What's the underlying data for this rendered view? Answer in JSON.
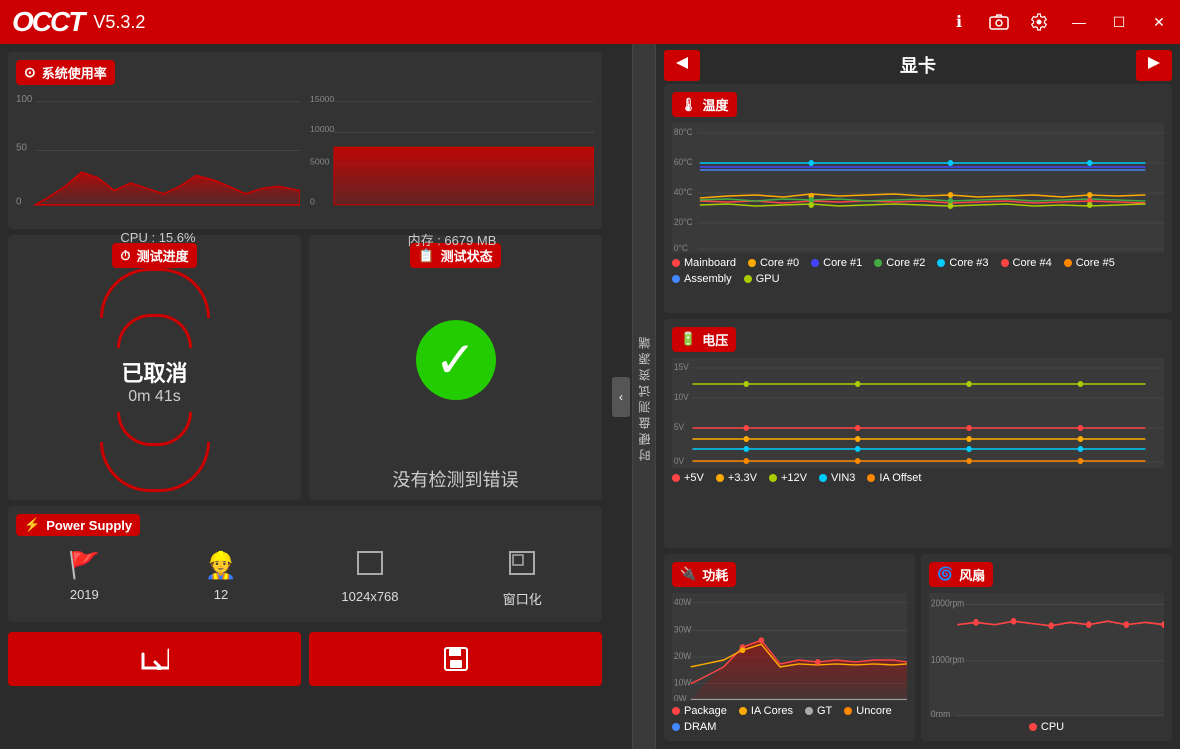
{
  "app": {
    "logo": "OCCT",
    "version": "V5.3.2",
    "title_controls": {
      "info": "ℹ",
      "screenshot": "📷",
      "settings": "🔧",
      "minimize": "—",
      "maximize": "☐",
      "close": "✕"
    }
  },
  "left": {
    "sys_usage_label": "系统使用率",
    "cpu_value": "CPU : 15.6%",
    "mem_value": "内存 : 6679 MB",
    "cpu_y_labels": [
      "100",
      "50",
      "0"
    ],
    "mem_y_labels": [
      "15000",
      "10000",
      "5000",
      "0"
    ],
    "test_progress_label": "测试进度",
    "test_status_label": "测试状态",
    "progress_main": "已取消",
    "progress_sub": "0m 41s",
    "status_text": "没有检测到错误",
    "power_supply_label": "Power Supply",
    "power_items": [
      {
        "icon": "🚩",
        "value": "2019"
      },
      {
        "icon": "👷",
        "value": "12"
      },
      {
        "icon": "⬛",
        "value": "1024x768"
      },
      {
        "icon": "⬜",
        "value": "窗口化"
      }
    ],
    "btn_enter": "↵",
    "btn_save": "💾"
  },
  "sidebar": {
    "text": "时硬盘测试资源端"
  },
  "right": {
    "gpu_title": "显卡",
    "temp_label": "温度",
    "temp_icon": "🌡",
    "voltage_label": "电压",
    "voltage_icon": "🔌",
    "power_label": "功耗",
    "power_icon": "🔌",
    "fan_label": "风扇",
    "fan_icon": "🌀",
    "temp_legend": [
      {
        "color": "#ff4444",
        "name": "Mainboard"
      },
      {
        "color": "#ffaa00",
        "name": "Core #0"
      },
      {
        "color": "#4444ff",
        "name": "Core #1"
      },
      {
        "color": "#44aa44",
        "name": "Core #2"
      },
      {
        "color": "#00ccff",
        "name": "Core #3"
      },
      {
        "color": "#ff4444",
        "name": "Core #4"
      },
      {
        "color": "#ff8800",
        "name": "Core #5"
      },
      {
        "color": "#4488ff",
        "name": "Assembly"
      },
      {
        "color": "#aacc00",
        "name": "GPU"
      }
    ],
    "voltage_legend": [
      {
        "color": "#ff4444",
        "name": "+5V"
      },
      {
        "color": "#ffaa00",
        "name": "+3.3V"
      },
      {
        "color": "#aacc00",
        "name": "+12V"
      },
      {
        "color": "#00ccff",
        "name": "VIN3"
      },
      {
        "color": "#ff8800",
        "name": "IA Offset"
      }
    ],
    "power_legend": [
      {
        "color": "#ff4444",
        "name": "Package"
      },
      {
        "color": "#ffaa00",
        "name": "IA Cores"
      },
      {
        "color": "#aaaaaa",
        "name": "GT"
      },
      {
        "color": "#ff8800",
        "name": "Uncore"
      },
      {
        "color": "#4488ff",
        "name": "DRAM"
      }
    ],
    "fan_legend": [
      {
        "color": "#ff4444",
        "name": "CPU"
      }
    ]
  }
}
